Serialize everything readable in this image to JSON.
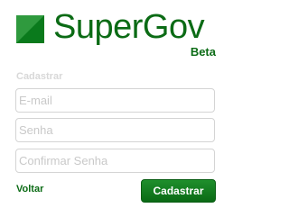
{
  "brand": {
    "name": "SuperGov",
    "badge": "Beta",
    "color": "#0b6b15"
  },
  "form": {
    "section_label": "Cadastrar",
    "fields": [
      {
        "placeholder": "E-mail",
        "value": ""
      },
      {
        "placeholder": "Senha",
        "value": ""
      },
      {
        "placeholder": "Confirmar Senha",
        "value": ""
      }
    ],
    "back_label": "Voltar",
    "submit_label": "Cadastrar"
  }
}
